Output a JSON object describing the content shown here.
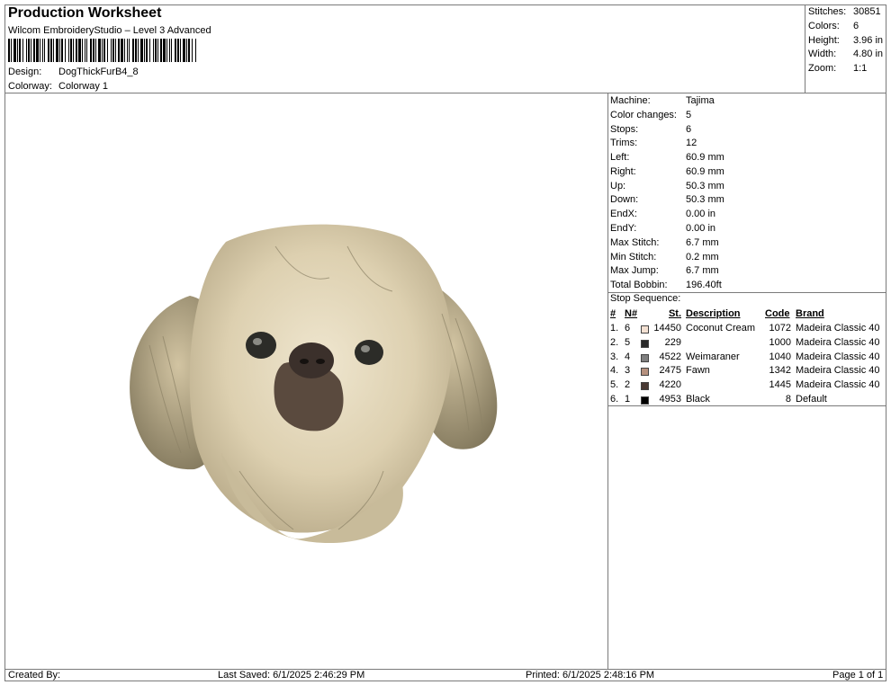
{
  "header": {
    "title": "Production Worksheet",
    "subtitle": "Wilcom EmbroideryStudio – Level 3 Advanced",
    "design_label": "Design:",
    "design_value": "DogThickFurB4_8",
    "colorway_label": "Colorway:",
    "colorway_value": "Colorway 1"
  },
  "summary": [
    {
      "label": "Stitches:",
      "value": "30851"
    },
    {
      "label": "Colors:",
      "value": "6"
    },
    {
      "label": "Height:",
      "value": "3.96 in"
    },
    {
      "label": "Width:",
      "value": "4.80 in"
    },
    {
      "label": "Zoom:",
      "value": "1:1"
    }
  ],
  "specs": [
    {
      "label": "Machine:",
      "value": "Tajima"
    },
    {
      "label": "Color changes:",
      "value": "5"
    },
    {
      "label": "Stops:",
      "value": "6"
    },
    {
      "label": "Trims:",
      "value": "12"
    },
    {
      "label": "Left:",
      "value": "60.9 mm"
    },
    {
      "label": "Right:",
      "value": "60.9 mm"
    },
    {
      "label": "Up:",
      "value": "50.3 mm"
    },
    {
      "label": "Down:",
      "value": "50.3 mm"
    },
    {
      "label": "EndX:",
      "value": "0.00 in"
    },
    {
      "label": "EndY:",
      "value": "0.00 in"
    },
    {
      "label": "Max Stitch:",
      "value": "6.7 mm"
    },
    {
      "label": "Min Stitch:",
      "value": "0.2 mm"
    },
    {
      "label": "Max Jump:",
      "value": "6.7 mm"
    },
    {
      "label": "Total Bobbin:",
      "value": "196.40ft"
    }
  ],
  "stop_sequence": {
    "title": "Stop Sequence:",
    "headers": {
      "index": "#",
      "needle": "N#",
      "stitches": "St.",
      "description": "Description",
      "code": "Code",
      "brand": "Brand"
    },
    "rows": [
      {
        "index": "1.",
        "needle": "6",
        "color": "#f3e0d2",
        "stitches": "14450",
        "description": "Coconut Cream",
        "code": "1072",
        "brand": "Madeira Classic 40"
      },
      {
        "index": "2.",
        "needle": "5",
        "color": "#2a2a2a",
        "stitches": "229",
        "description": "",
        "code": "1000",
        "brand": "Madeira Classic 40"
      },
      {
        "index": "3.",
        "needle": "4",
        "color": "#7f7f7f",
        "stitches": "4522",
        "description": "Weimaraner",
        "code": "1040",
        "brand": "Madeira Classic 40"
      },
      {
        "index": "4.",
        "needle": "3",
        "color": "#b6917e",
        "stitches": "2475",
        "description": "Fawn",
        "code": "1342",
        "brand": "Madeira Classic 40"
      },
      {
        "index": "5.",
        "needle": "2",
        "color": "#4a3a34",
        "stitches": "4220",
        "description": "",
        "code": "1445",
        "brand": "Madeira Classic 40"
      },
      {
        "index": "6.",
        "needle": "1",
        "color": "#000000",
        "stitches": "4953",
        "description": "Black",
        "code": "8",
        "brand": "Default"
      }
    ]
  },
  "footer": {
    "created_by": "Created By:",
    "last_saved": "Last Saved: 6/1/2025 2:46:29 PM",
    "printed": "Printed: 6/1/2025 2:48:16 PM",
    "page": "Page 1 of 1"
  }
}
